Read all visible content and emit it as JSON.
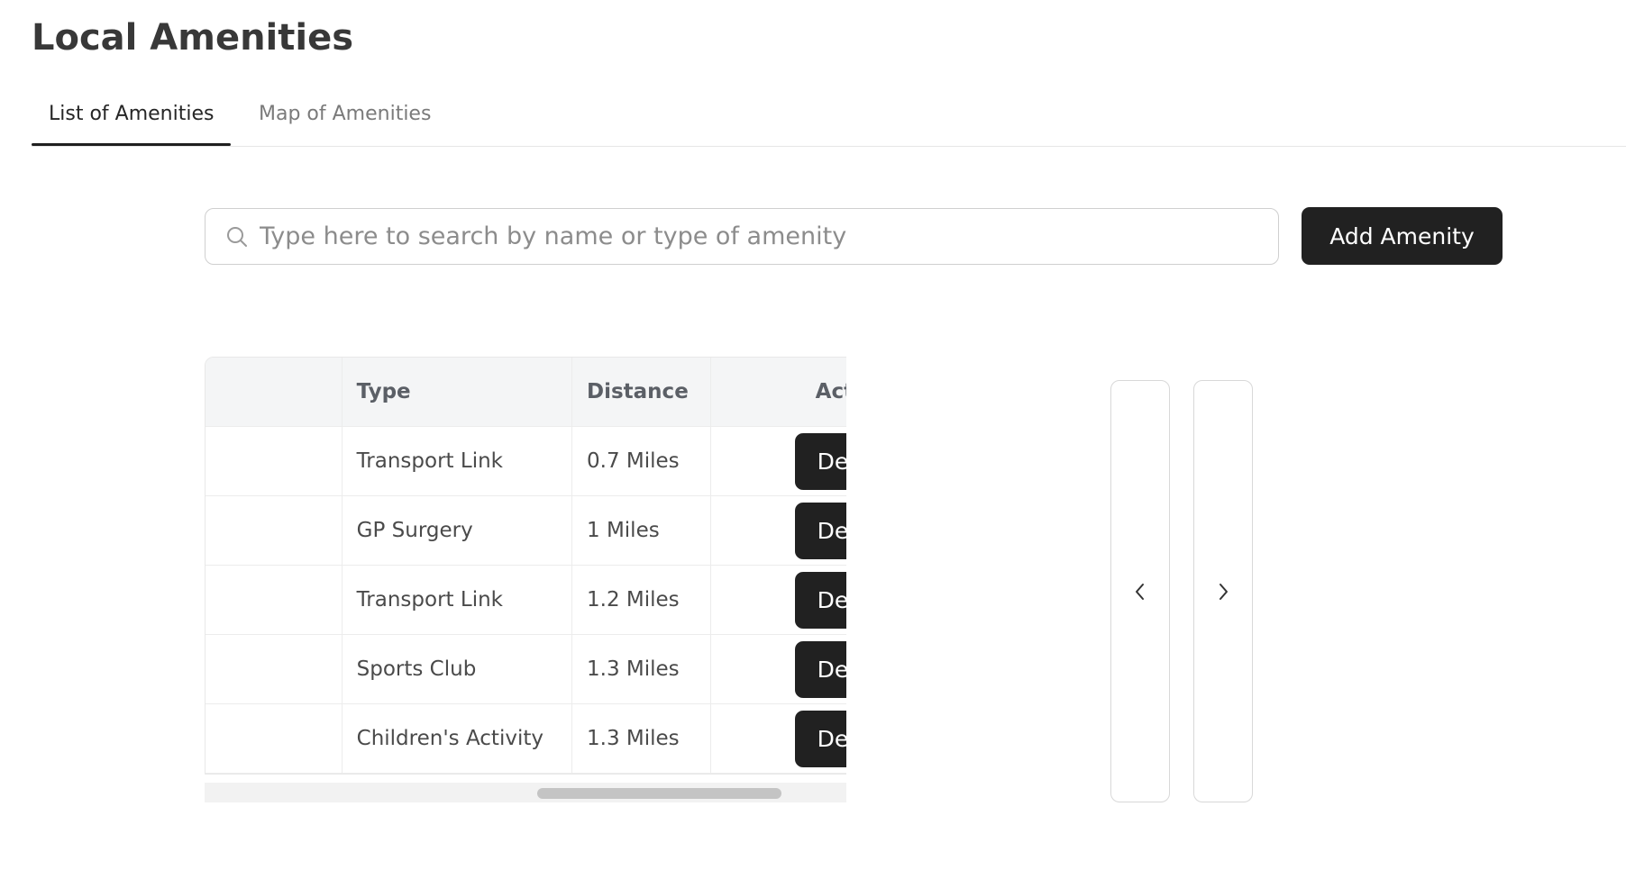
{
  "page": {
    "title": "Local Amenities"
  },
  "tabs": [
    {
      "label": "List of Amenities",
      "active": true
    },
    {
      "label": "Map of Amenities",
      "active": false
    }
  ],
  "search": {
    "placeholder": "Type here to search by name or type of amenity",
    "value": "",
    "icon": "search-icon"
  },
  "actions": {
    "add_label": "Add Amenity"
  },
  "table": {
    "headers": {
      "name": "",
      "type": "Type",
      "distance": "Distance",
      "action": "Act"
    },
    "rows": [
      {
        "name": "",
        "type": "Transport Link",
        "distance": "0.7 Miles",
        "action": "De"
      },
      {
        "name": "",
        "type": "GP Surgery",
        "distance": "1 Miles",
        "action": "De"
      },
      {
        "name": "",
        "type": "Transport Link",
        "distance": "1.2 Miles",
        "action": "De"
      },
      {
        "name": "",
        "type": "Sports Club",
        "distance": "1.3 Miles",
        "action": "De"
      },
      {
        "name": "",
        "type": "Children's Activity",
        "distance": "1.3 Miles",
        "action": "De"
      }
    ]
  },
  "pager": {
    "prev_icon": "chevron-left-icon",
    "next_icon": "chevron-right-icon"
  },
  "colors": {
    "primary_dark": "#212121",
    "header_bg": "#f4f5f6",
    "border": "#e8e8e8"
  }
}
